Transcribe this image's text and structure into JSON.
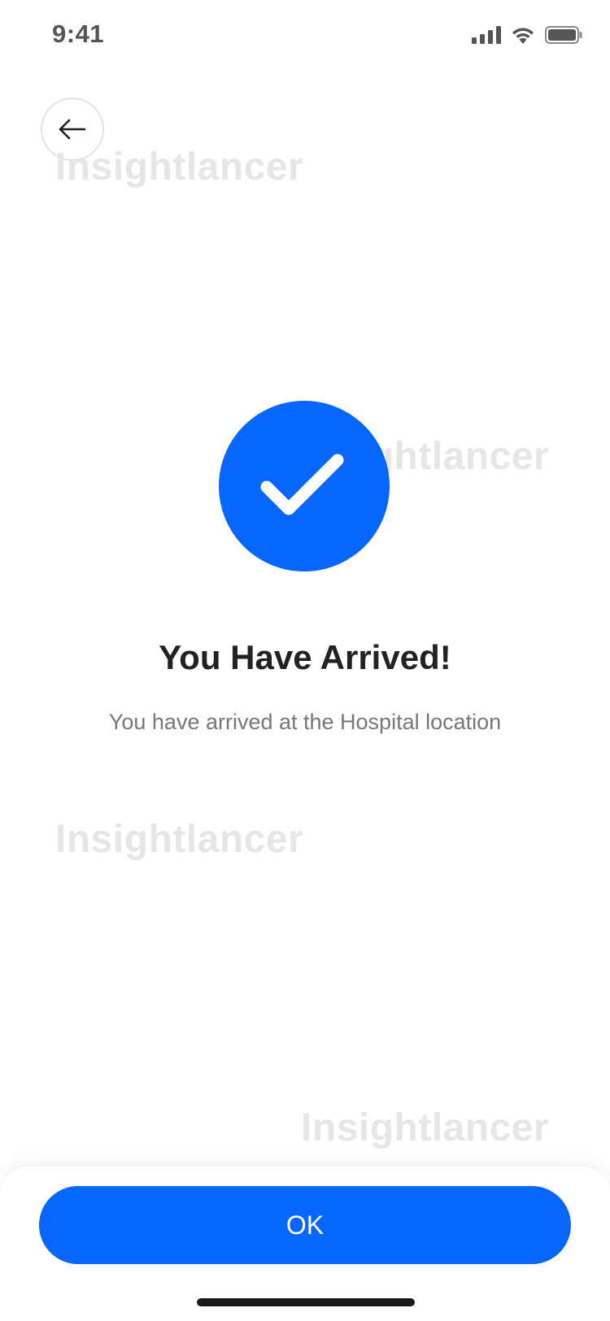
{
  "status_bar": {
    "time": "9:41",
    "icons": [
      "cellular-signal-icon",
      "wifi-icon",
      "battery-icon"
    ]
  },
  "header": {
    "back_icon": "arrow-left-icon"
  },
  "watermark": {
    "text": "Insightlancer"
  },
  "confirmation": {
    "icon": "checkmark-icon",
    "title": "You Have Arrived!",
    "message": "You have arrived at the Hospital location"
  },
  "actions": {
    "ok_label": "OK"
  },
  "colors": {
    "accent": "#0766FF",
    "title_text": "#222222",
    "body_text": "#777777",
    "watermark": "#E6E6E6"
  }
}
